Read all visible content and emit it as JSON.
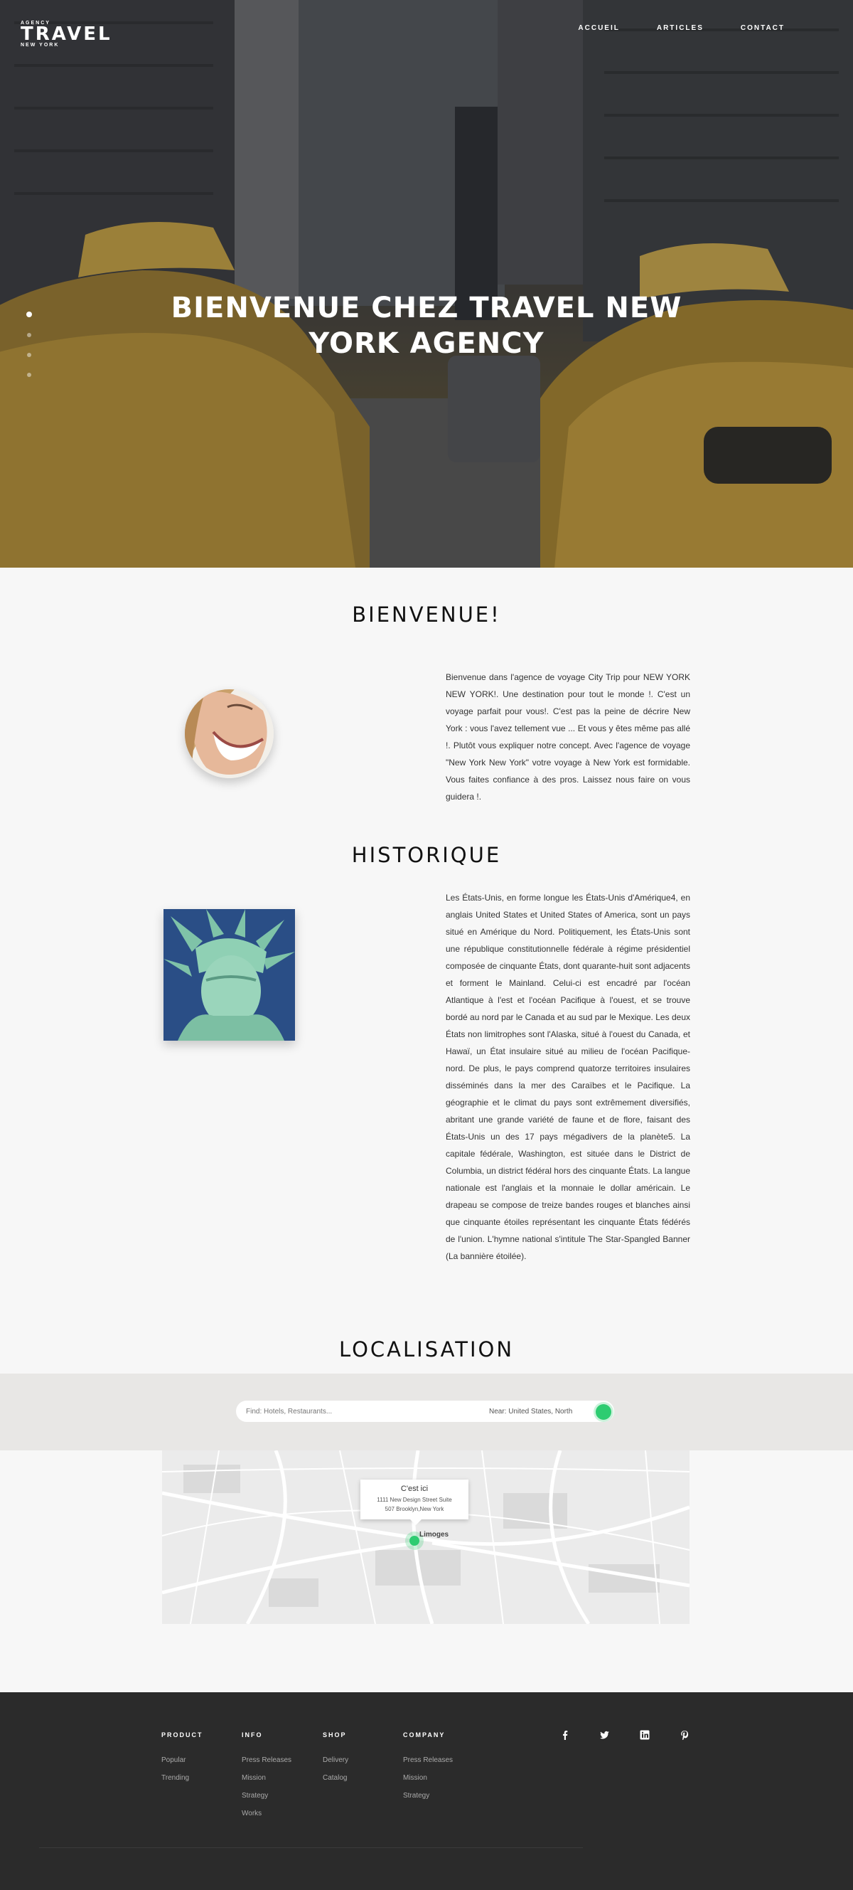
{
  "header": {
    "logo": {
      "top": "AGENCY",
      "main": "TRAVEL",
      "bottom": "NEW YORK"
    },
    "nav": [
      "ACCUEIL",
      "ARTICLES",
      "CONTACT"
    ]
  },
  "hero": {
    "title": "BIENVENUE CHEZ TRAVEL NEW YORK AGENCY",
    "slides": 4,
    "active_slide": 1
  },
  "bienvenue": {
    "title": "BIENVENUE!",
    "text": "Bienvenue dans l'agence de voyage City Trip pour NEW YORK NEW YORK!. Une destination pour tout le monde !. C'est un voyage parfait pour vous!. C'est pas la peine de décrire New York : vous l'avez tellement vue ... Et vous y êtes même pas allé !. Plutôt vous expliquer notre concept. Avec l'agence de voyage \"New York New York\" votre voyage à New York est formidable. Vous faites confiance à des pros. Laissez nous faire on vous guidera !."
  },
  "historique": {
    "title": "HISTORIQUE",
    "text": "Les États-Unis, en forme longue les États-Unis d'Amérique4, en anglais United States et United States of America, sont un pays situé en Amérique du Nord. Politiquement, les États-Unis sont une république constitutionnelle fédérale à régime présidentiel composée de cinquante États, dont quarante-huit sont adjacents et forment le Mainland. Celui-ci est encadré par l'océan Atlantique à l'est et l'océan Pacifique à l'ouest, et se trouve bordé au nord par le Canada et au sud par le Mexique. Les deux États non limitrophes sont l'Alaska, situé à l'ouest du Canada, et Hawaï, un État insulaire situé au milieu de l'océan Pacifique-nord. De plus, le pays comprend quatorze territoires insulaires disséminés dans la mer des Caraïbes et le Pacifique. La géographie et le climat du pays sont extrêmement diversifiés, abritant une grande variété de faune et de flore, faisant des États-Unis un des 17 pays mégadivers de la planète5. La capitale fédérale, Washington, est située dans le District de Columbia, un district fédéral hors des cinquante États. La langue nationale est l'anglais et la monnaie le dollar américain. Le drapeau se compose de treize bandes rouges et blanches ainsi que cinquante étoiles représentant les cinquante États fédérés de l'union. L'hymne national s'intitule The Star-Spangled Banner (La bannière étoilée)."
  },
  "localisation": {
    "title": "LOCALISATION",
    "find_placeholder": "Find: Hotels, Restaurants...",
    "near_value": "Near: United States, North",
    "popup_title": "C'est ici",
    "popup_line1": "1111 New Design Street Suite",
    "popup_line2": "507 Brooklyn,New York",
    "city_label": "Limoges",
    "accent": "#2ecc71"
  },
  "footer": {
    "columns": [
      {
        "title": "PRODUCT",
        "links": [
          "Popular",
          "Trending"
        ]
      },
      {
        "title": "INFO",
        "links": [
          "Press Releases",
          "Mission",
          "Strategy",
          "Works"
        ]
      },
      {
        "title": "SHOP",
        "links": [
          "Delivery",
          "Catalog"
        ]
      },
      {
        "title": "COMPANY",
        "links": [
          "Press Releases",
          "Mission",
          "Strategy"
        ]
      }
    ],
    "social": [
      "facebook-icon",
      "twitter-icon",
      "linkedin-icon",
      "pinterest-icon"
    ]
  }
}
